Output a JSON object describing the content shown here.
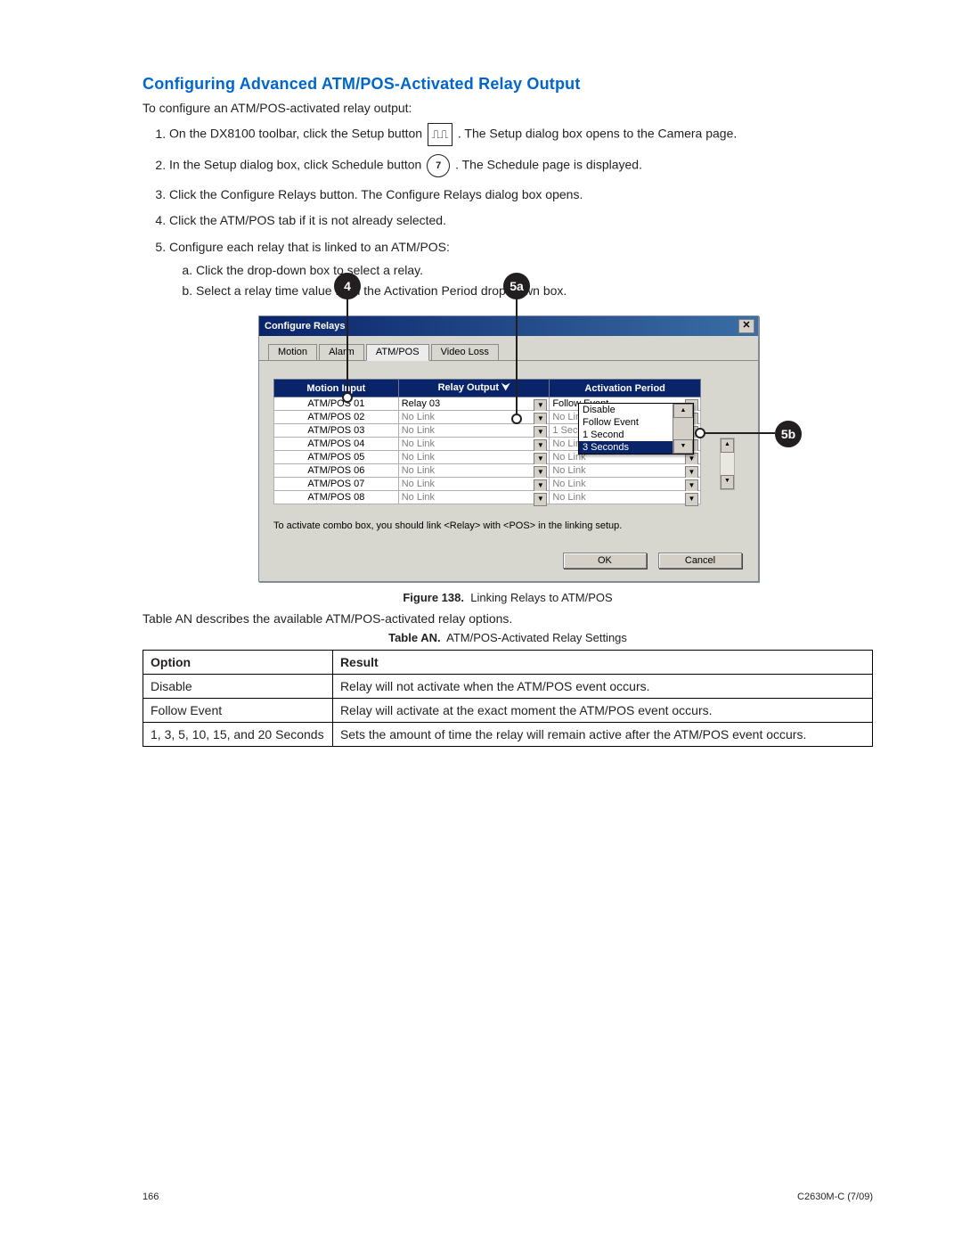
{
  "heading": "Configuring Advanced ATM/POS-Activated Relay Output",
  "intro": "To configure an ATM/POS-activated relay output:",
  "steps": {
    "s1a": "On the DX8100 toolbar, click the Setup button ",
    "s1b": ". The Setup dialog box opens to the Camera page.",
    "s2a": "In the Setup dialog box, click Schedule button ",
    "s2b": ". The Schedule page is displayed.",
    "s3": "Click the Configure Relays button. The Configure Relays dialog box opens.",
    "s4": "Click the ATM/POS tab if it is not already selected.",
    "s5": "Configure each relay that is linked to an ATM/POS:",
    "s5a": "Click the drop-down box to select a relay.",
    "s5b": "Select a relay time value from the Activation Period drop-down box."
  },
  "step_icons": {
    "setup": "⎍⎍",
    "schedule": "7"
  },
  "callouts": {
    "c4": "4",
    "c5a": "5a",
    "c5b": "5b"
  },
  "dialog": {
    "title": "Configure Relays",
    "tabs": [
      "Motion",
      "Alarm",
      "ATM/POS",
      "Video Loss"
    ],
    "active_tab": "ATM/POS",
    "columns": {
      "col1": "Motion Input",
      "col2": "Relay Output",
      "col3": "Activation Period"
    },
    "rows": [
      {
        "in": "ATM/POS 01",
        "out": "Relay 03",
        "act": "Follow Event"
      },
      {
        "in": "ATM/POS 02",
        "out": "No Link",
        "act": "No Link"
      },
      {
        "in": "ATM/POS 03",
        "out": "No Link",
        "act": "1 Second"
      },
      {
        "in": "ATM/POS 04",
        "out": "No Link",
        "act": "No Link"
      },
      {
        "in": "ATM/POS 05",
        "out": "No Link",
        "act": "No Link"
      },
      {
        "in": "ATM/POS 06",
        "out": "No Link",
        "act": "No Link"
      },
      {
        "in": "ATM/POS 07",
        "out": "No Link",
        "act": "No Link"
      },
      {
        "in": "ATM/POS 08",
        "out": "No Link",
        "act": "No Link"
      }
    ],
    "dropdown_options": [
      "Disable",
      "Follow Event",
      "1 Second",
      "3 Seconds"
    ],
    "dropdown_selected": "3 Seconds",
    "hint": "To activate combo box, you should link <Relay> with <POS> in the linking setup.",
    "ok": "OK",
    "cancel": "Cancel",
    "close_glyph": "✕"
  },
  "figure": {
    "label": "Figure 138.",
    "caption": "Linking Relays to ATM/POS"
  },
  "table_intro": "Table AN describes the available ATM/POS-activated relay options.",
  "table_caption": {
    "label": "Table AN.",
    "caption": "ATM/POS-Activated Relay Settings"
  },
  "opt_table": {
    "head": {
      "option": "Option",
      "result": "Result"
    },
    "rows": [
      {
        "o": "Disable",
        "r": "Relay will not activate when the ATM/POS event occurs."
      },
      {
        "o": "Follow Event",
        "r": "Relay will activate at the exact moment the ATM/POS event occurs."
      },
      {
        "o": "1, 3, 5, 10, 15, and 20 Seconds",
        "r": "Sets the amount of time the relay will remain active after the ATM/POS event occurs."
      }
    ]
  },
  "footer": {
    "page": "166",
    "doc": "C2630M-C (7/09)"
  }
}
